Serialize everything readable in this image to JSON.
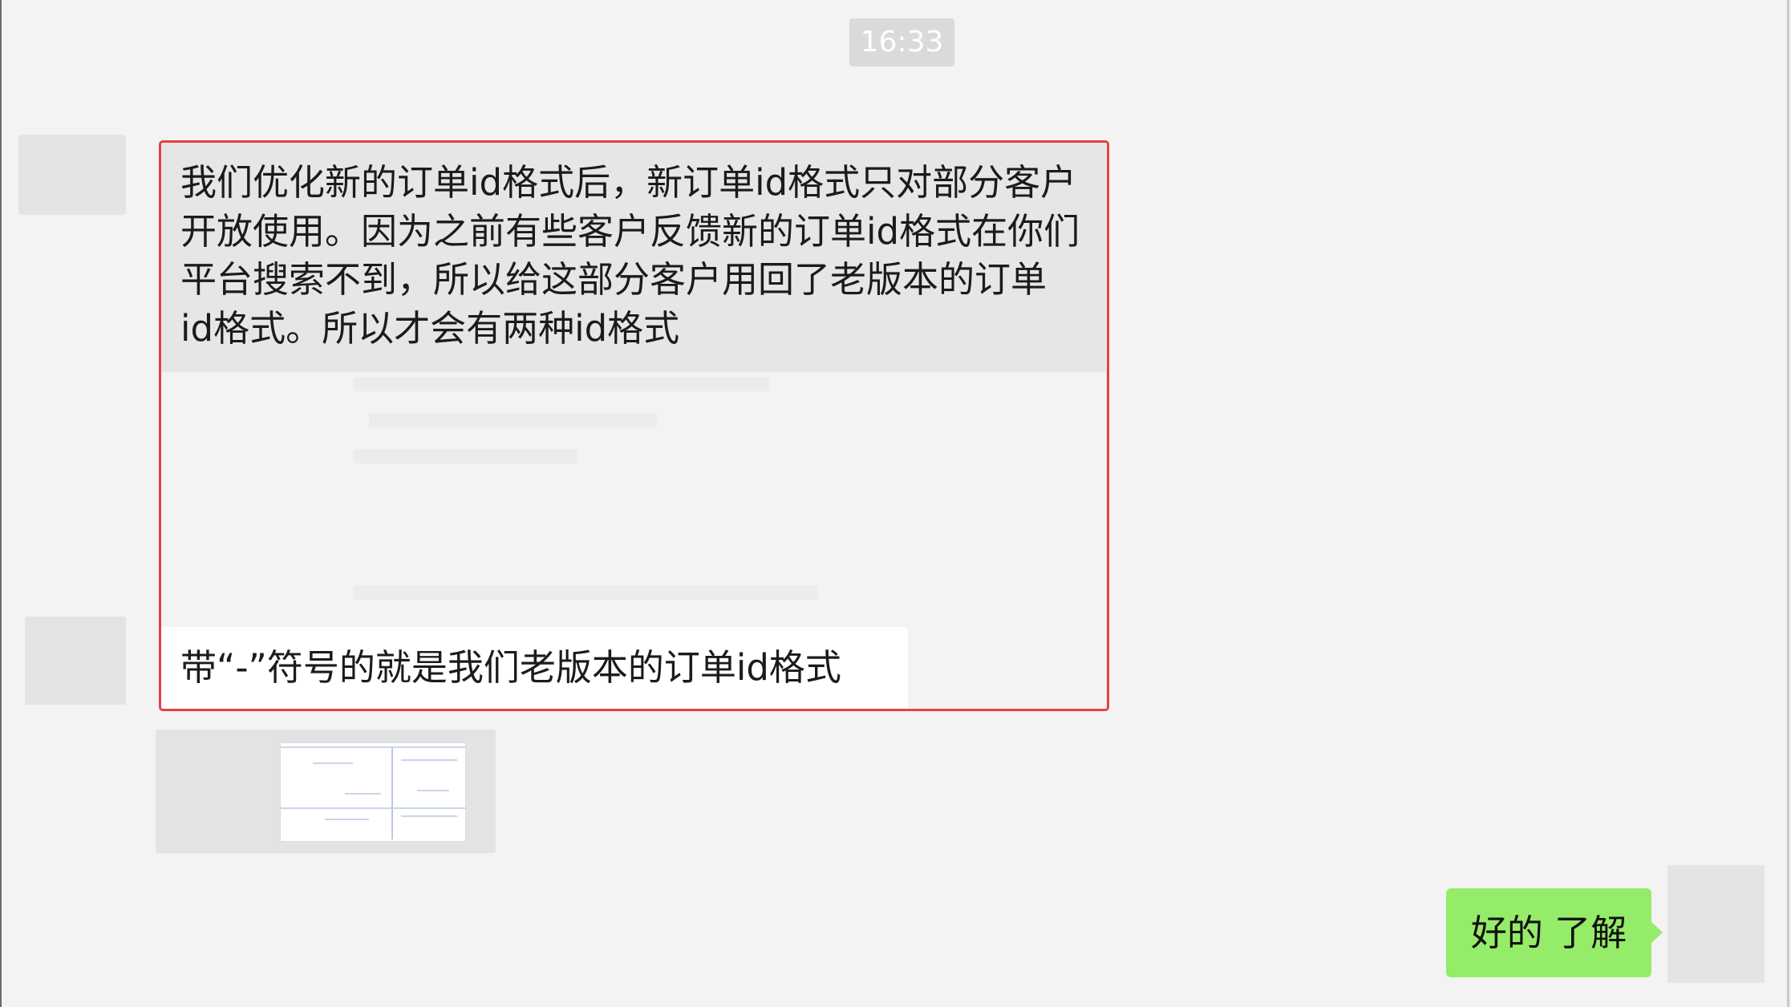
{
  "timestamp": "16:33",
  "chat": {
    "incoming_1": {
      "lines": [
        "我们优化新的订单id格式后，新订单id格式只对部分客户",
        "开放使用。因为之前有些客户反馈新的订单id格式在你们",
        "平台搜索不到，所以给这部分客户用回了老版本的订单",
        "id格式。所以才会有两种id格式"
      ]
    },
    "incoming_2": {
      "text": "带“-”符号的就是我们老版本的订单id格式"
    },
    "outgoing_1": {
      "text": "好的 了解"
    }
  },
  "colors": {
    "background": "#f3f3f3",
    "outgoing_bubble": "#95ec69",
    "incoming_bubble": "#ffffff",
    "quoted_bubble": "#e6e6e6",
    "highlight_border": "#e8403f"
  }
}
